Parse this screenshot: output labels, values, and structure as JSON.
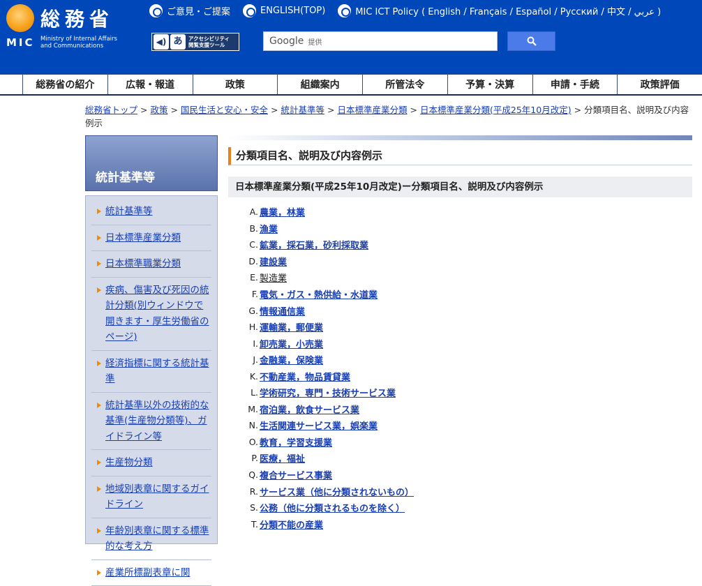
{
  "header": {
    "logo_jp": "総務省",
    "logo_abbr": "MIC",
    "logo_en_line1": "Ministry of Internal Affairs",
    "logo_en_line2": "and Communications",
    "top_links": [
      {
        "label": "ご意見・ご提案"
      },
      {
        "label": "ENGLISH(TOP)"
      },
      {
        "label": "MIC ICT Policy ( English / Français / Español / Русский / 中文 / عربي )"
      }
    ],
    "accessibility": {
      "line1": "アクセシビリティ",
      "line2": "閲覧支援ツール"
    },
    "search": {
      "brand": "Google",
      "provided": "提供"
    },
    "brand_color": "#0047ba"
  },
  "gnav": [
    {
      "label": "総務省の紹介"
    },
    {
      "label": "広報・報道"
    },
    {
      "label": "政策"
    },
    {
      "label": "組織案内"
    },
    {
      "label": "所管法令"
    },
    {
      "label": "予算・決算"
    },
    {
      "label": "申請・手続"
    },
    {
      "label": "政策評価"
    }
  ],
  "breadcrumb": {
    "links": [
      "総務省トップ",
      "政策",
      "国民生活と安心・安全",
      "統計基準等",
      "日本標準産業分類",
      "日本標準産業分類(平成25年10月改定)"
    ],
    "separator": ">",
    "current": "分類項目名、説明及び内容例示"
  },
  "sidebar": {
    "title": "統計基準等",
    "items": [
      {
        "label": "統計基準等"
      },
      {
        "label": "日本標準産業分類"
      },
      {
        "label": "日本標準職業分類"
      },
      {
        "label": "疾病、傷害及び死因の統計分類(別ウィンドウで開きます・厚生労働省のページ)"
      },
      {
        "label": "経済指標に関する統計基準"
      },
      {
        "label": "統計基準以外の技術的な基準(生産物分類等)、ガイドライン等"
      },
      {
        "label": "生産物分類"
      },
      {
        "label": "地域別表章に関するガイドライン"
      },
      {
        "label": "年齢別表章に関する標準的な考え方"
      },
      {
        "label": "産業所標副表章に関"
      }
    ]
  },
  "main": {
    "title": "分類項目名、説明及び内容例示",
    "subtitle": "日本標準産業分類(平成25年10月改定)ー分類項目名、説明及び内容例示",
    "categories": [
      {
        "letter": "A.",
        "label": "農業，林業"
      },
      {
        "letter": "B.",
        "label": "漁業"
      },
      {
        "letter": "C.",
        "label": "鉱業，採石業，砂利採取業"
      },
      {
        "letter": "D.",
        "label": "建設業"
      },
      {
        "letter": "E.",
        "label": "製造業"
      },
      {
        "letter": "F.",
        "label": "電気・ガス・熱供給・水道業"
      },
      {
        "letter": "G.",
        "label": "情報通信業"
      },
      {
        "letter": "H.",
        "label": "運輸業，郵便業"
      },
      {
        "letter": "I.",
        "label": "卸売業，小売業"
      },
      {
        "letter": "J.",
        "label": "金融業，保険業"
      },
      {
        "letter": "K.",
        "label": "不動産業，物品賃貸業"
      },
      {
        "letter": "L.",
        "label": "学術研究，専門・技術サービス業"
      },
      {
        "letter": "M.",
        "label": "宿泊業，飲食サービス業"
      },
      {
        "letter": "N.",
        "label": "生活関連サービス業，娯楽業"
      },
      {
        "letter": "O.",
        "label": "教育，学習支援業"
      },
      {
        "letter": "P.",
        "label": "医療，福祉"
      },
      {
        "letter": "Q.",
        "label": "複合サービス事業"
      },
      {
        "letter": "R.",
        "label": "サービス業（他に分類されないもの）"
      },
      {
        "letter": "S.",
        "label": "公務（他に分類されるものを除く）"
      },
      {
        "letter": "T.",
        "label": "分類不能の産業"
      }
    ]
  }
}
